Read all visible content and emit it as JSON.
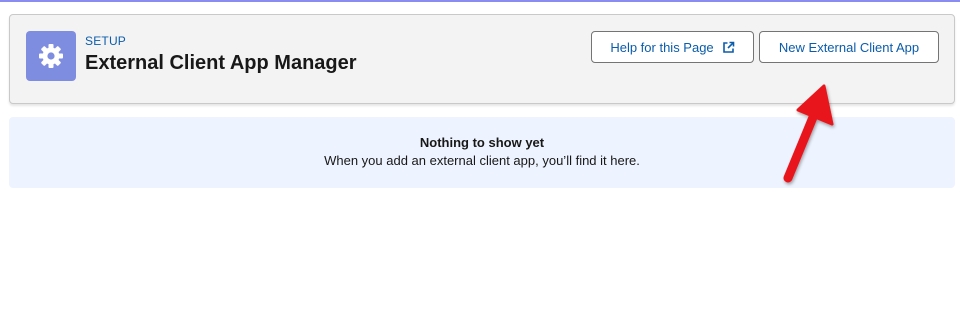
{
  "header": {
    "eyebrow": "SETUP",
    "title": "External Client App Manager",
    "icon": "gear-icon",
    "icon_bg": "#7f8de1"
  },
  "actions": {
    "help_label": "Help for this Page",
    "help_icon": "external-link-icon",
    "new_label": "New External Client App"
  },
  "empty_state": {
    "title": "Nothing to show yet",
    "message": "When you add an external client app, you’ll find it here."
  },
  "annotation": {
    "type": "red-arrow",
    "color": "#e8191c",
    "points_to": "New External Client App"
  }
}
